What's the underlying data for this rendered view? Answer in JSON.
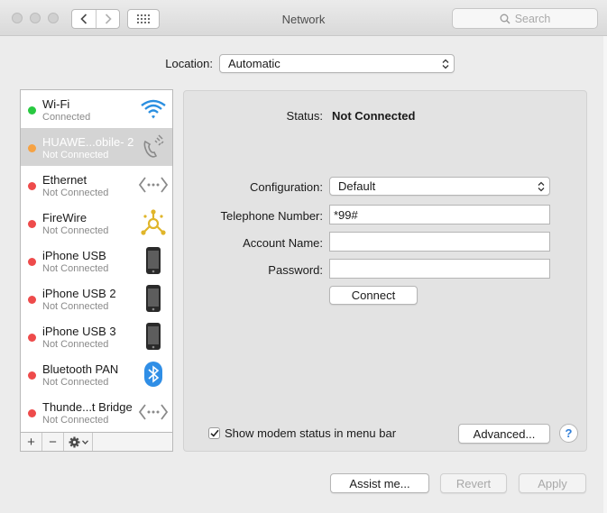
{
  "window": {
    "title": "Network"
  },
  "search": {
    "placeholder": "Search"
  },
  "location": {
    "label": "Location:",
    "value": "Automatic"
  },
  "services": [
    {
      "name": "Wi-Fi",
      "status": "Connected",
      "dot": "#28c940",
      "icon": "wifi-icon"
    },
    {
      "name": "HUAWE...obile- 2",
      "status": "Not Connected",
      "dot": "#f6a243",
      "icon": "phone-modem-icon",
      "selected": true
    },
    {
      "name": "Ethernet",
      "status": "Not Connected",
      "dot": "#ee4b4b",
      "icon": "ethernet-icon"
    },
    {
      "name": "FireWire",
      "status": "Not Connected",
      "dot": "#ee4b4b",
      "icon": "firewire-icon"
    },
    {
      "name": "iPhone USB",
      "status": "Not Connected",
      "dot": "#ee4b4b",
      "icon": "iphone-icon"
    },
    {
      "name": "iPhone USB 2",
      "status": "Not Connected",
      "dot": "#ee4b4b",
      "icon": "iphone-icon"
    },
    {
      "name": "iPhone USB 3",
      "status": "Not Connected",
      "dot": "#ee4b4b",
      "icon": "iphone-icon"
    },
    {
      "name": "Bluetooth PAN",
      "status": "Not Connected",
      "dot": "#ee4b4b",
      "icon": "bluetooth-icon"
    },
    {
      "name": "Thunde...t Bridge",
      "status": "Not Connected",
      "dot": "#ee4b4b",
      "icon": "thunderbolt-bridge-icon"
    }
  ],
  "sidebar_controls": {
    "add": "+",
    "remove": "−"
  },
  "detail": {
    "status_label": "Status:",
    "status_value": "Not Connected",
    "configuration_label": "Configuration:",
    "configuration_value": "Default",
    "telephone_label": "Telephone Number:",
    "telephone_value": "*99#",
    "account_label": "Account Name:",
    "account_value": "",
    "password_label": "Password:",
    "password_value": "",
    "connect_label": "Connect",
    "show_modem_label": "Show modem status in menu bar",
    "show_modem_checked": true,
    "advanced_label": "Advanced...",
    "help_label": "?"
  },
  "footer": {
    "assist_label": "Assist me...",
    "revert_label": "Revert",
    "apply_label": "Apply"
  },
  "colors": {
    "accent": "#2f7ed8",
    "selected_row": "#d4d4d4"
  }
}
